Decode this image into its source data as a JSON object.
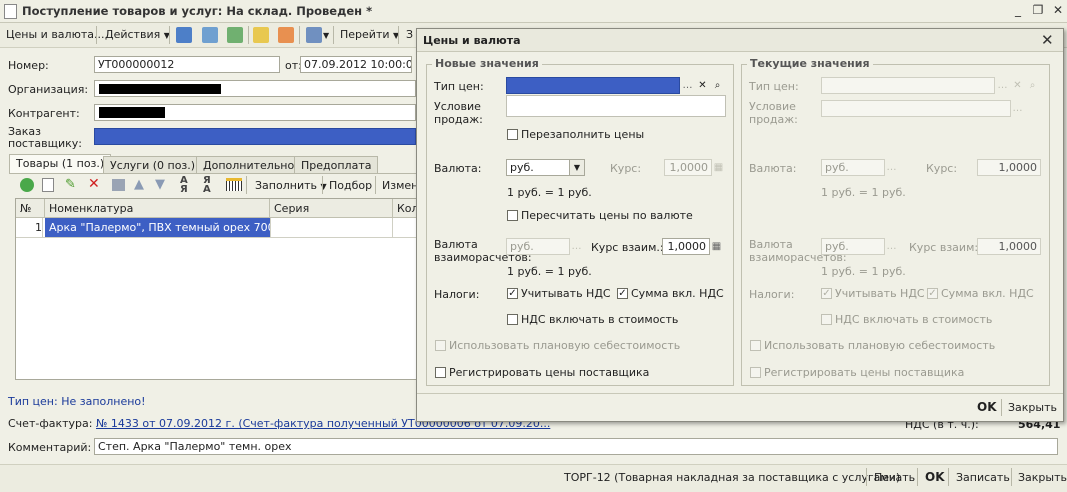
{
  "window": {
    "title": "Поступление товаров и услуг: На склад. Проведен *"
  },
  "toolbar": {
    "prices_label": "Цены и валюта...",
    "actions_label": "Действия",
    "goto_label": "Перейти",
    "cut_label": "З"
  },
  "form": {
    "number_label": "Номер:",
    "number_value": "УТ000000012",
    "date_label": "от:",
    "date_value": "07.09.2012 10:00:00",
    "org_label": "Организация:",
    "contractor_label": "Контрагент:",
    "order_label": "Заказ поставщику:",
    "tabs": [
      "Товары (1 поз.)",
      "Услуги (0 поз.)",
      "Дополнительно",
      "Предоплата"
    ],
    "fill_label": "Заполнить",
    "select_label": "Подбор",
    "change_label": "Измен",
    "grid_headers": [
      "№",
      "Номенклатура",
      "Серия",
      "Кол"
    ],
    "grid_rows": [
      {
        "n": "1",
        "name": "Арка \"Палермо\", ПВХ темный орех 700\"..."
      }
    ],
    "price_type_status": "Тип цен: Не заполнено!",
    "invoice_label": "Счет-фактура:",
    "invoice_value": "№ 1433 от 07.09.2012 г. (Счет-фактура полученный УТ00000006 от 07.09.20...",
    "vat_label": "НДС (в т. ч.):",
    "vat_value": "564,41",
    "comment_label": "Комментарий:",
    "comment_value": "Степ. Арка \"Палермо\" темн. орех"
  },
  "bottombar": {
    "torg12_label": "ТОРГ-12 (Товарная накладная за поставщика с услугами)",
    "print_label": "Печать",
    "ok_label": "OK",
    "save_label": "Записать",
    "close_label": "Закрыть"
  },
  "dialog": {
    "title": "Цены и валюта",
    "new_group_title": "Новые значения",
    "current_group_title": "Текущие значения",
    "price_type_label": "Тип цен:",
    "sale_condition_label": "Условие продаж:",
    "refill_prices_label": "Перезаполнить цены",
    "currency_label": "Валюта:",
    "currency_value": "руб.",
    "rate_label": "Курс:",
    "rate_value": "1,0000",
    "rate_hint": "1 руб. = 1 руб.",
    "recalc_label": "Пересчитать цены по валюте",
    "settle_currency_label": "Валюта взаиморасчетов:",
    "settle_currency_value": "руб.",
    "settle_rate_label": "Курс взаим.:",
    "settle_rate_label_current": "Курс взаим:",
    "settle_rate_value": "1,0000",
    "settle_hint": "1 руб. = 1 руб.",
    "taxes_label": "Налоги:",
    "consider_vat_label": "Учитывать НДС",
    "sum_incl_vat_label": "Сумма вкл. НДС",
    "vat_in_cost_label": "НДС включать в стоимость",
    "planned_cost_label": "Использовать плановую себестоимость",
    "register_prices_label": "Регистрировать цены поставщика",
    "ok_label": "OK",
    "close_label": "Закрыть"
  },
  "colors": {
    "selection_blue": "#3d5fc4",
    "link_blue": "#1a3a9a",
    "background": "#f0f0e6"
  }
}
